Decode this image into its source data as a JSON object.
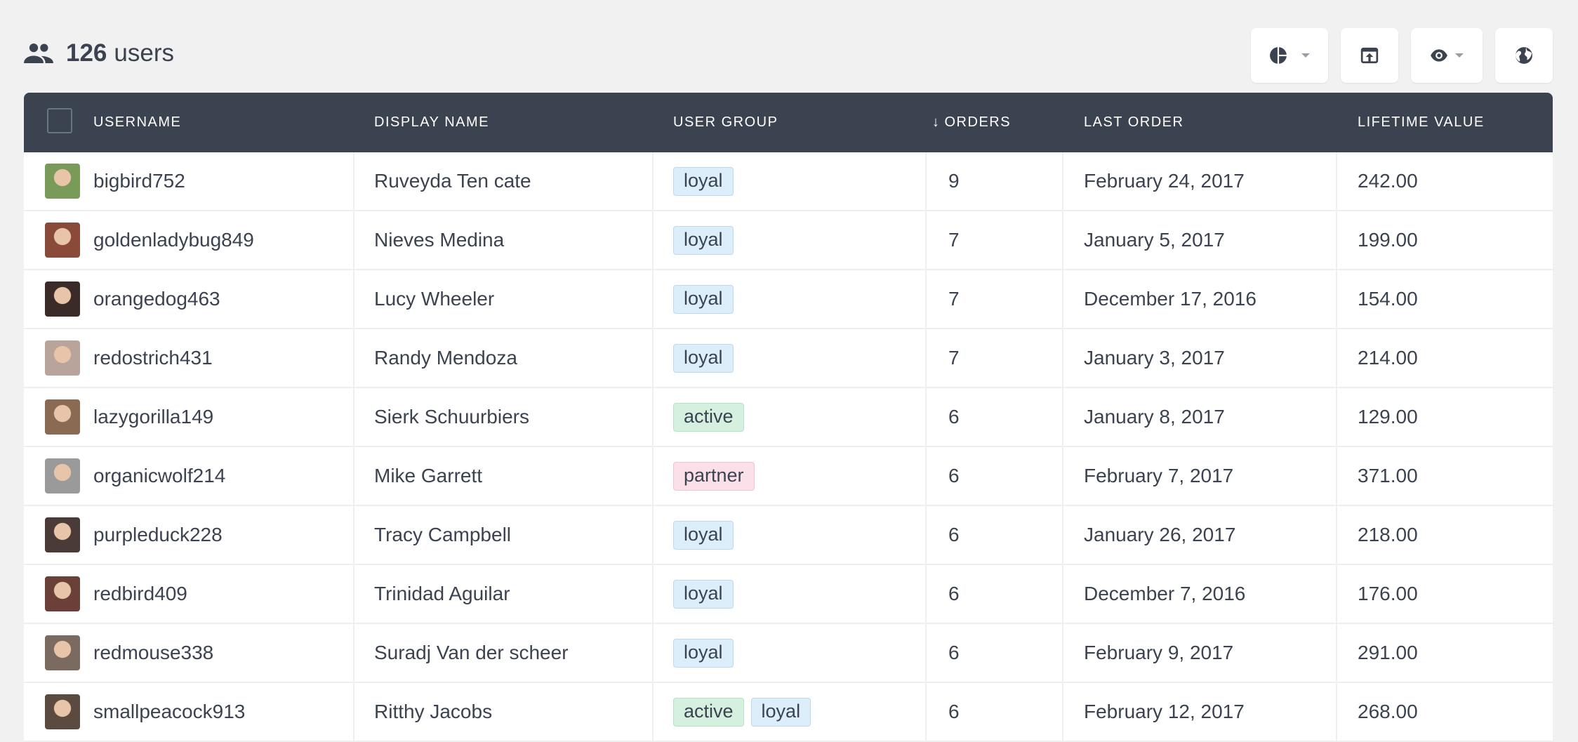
{
  "header": {
    "icon": "users-icon",
    "count": "126",
    "label": "users"
  },
  "toolbar": [
    {
      "name": "chart-button",
      "icon": "pie-chart-icon",
      "dropdown": true
    },
    {
      "name": "export-button",
      "icon": "export-icon",
      "dropdown": false
    },
    {
      "name": "visibility-button",
      "icon": "eye-icon",
      "dropdown": true
    },
    {
      "name": "globe-button",
      "icon": "globe-icon",
      "dropdown": false
    }
  ],
  "table": {
    "columns": [
      "USERNAME",
      "DISPLAY NAME",
      "USER GROUP",
      "ORDERS",
      "LAST ORDER",
      "LIFETIME VALUE"
    ],
    "sort_indicator": "↓",
    "sorted_column": "ORDERS",
    "rows": [
      {
        "username": "bigbird752",
        "display": "Ruveyda Ten cate",
        "groups": [
          "loyal"
        ],
        "orders": "9",
        "last": "February 24, 2017",
        "ltv": "242.00",
        "avatar": "#7a9a5a"
      },
      {
        "username": "goldenladybug849",
        "display": "Nieves Medina",
        "groups": [
          "loyal"
        ],
        "orders": "7",
        "last": "January 5, 2017",
        "ltv": "199.00",
        "avatar": "#8a4a3a"
      },
      {
        "username": "orangedog463",
        "display": "Lucy Wheeler",
        "groups": [
          "loyal"
        ],
        "orders": "7",
        "last": "December 17, 2016",
        "ltv": "154.00",
        "avatar": "#3a2a28"
      },
      {
        "username": "redostrich431",
        "display": "Randy Mendoza",
        "groups": [
          "loyal"
        ],
        "orders": "7",
        "last": "January 3, 2017",
        "ltv": "214.00",
        "avatar": "#b8a49a"
      },
      {
        "username": "lazygorilla149",
        "display": "Sierk Schuurbiers",
        "groups": [
          "active"
        ],
        "orders": "6",
        "last": "January 8, 2017",
        "ltv": "129.00",
        "avatar": "#8a6a52"
      },
      {
        "username": "organicwolf214",
        "display": "Mike Garrett",
        "groups": [
          "partner"
        ],
        "orders": "6",
        "last": "February 7, 2017",
        "ltv": "371.00",
        "avatar": "#9a9a9a"
      },
      {
        "username": "purpleduck228",
        "display": "Tracy Campbell",
        "groups": [
          "loyal"
        ],
        "orders": "6",
        "last": "January 26, 2017",
        "ltv": "218.00",
        "avatar": "#4a3a38"
      },
      {
        "username": "redbird409",
        "display": "Trinidad Aguilar",
        "groups": [
          "loyal"
        ],
        "orders": "6",
        "last": "December 7, 2016",
        "ltv": "176.00",
        "avatar": "#6a4038"
      },
      {
        "username": "redmouse338",
        "display": "Suradj Van der scheer",
        "groups": [
          "loyal"
        ],
        "orders": "6",
        "last": "February 9, 2017",
        "ltv": "291.00",
        "avatar": "#7a6a60"
      },
      {
        "username": "smallpeacock913",
        "display": "Ritthy Jacobs",
        "groups": [
          "active",
          "loyal"
        ],
        "orders": "6",
        "last": "February 12, 2017",
        "ltv": "268.00",
        "avatar": "#5a4a40"
      }
    ]
  }
}
